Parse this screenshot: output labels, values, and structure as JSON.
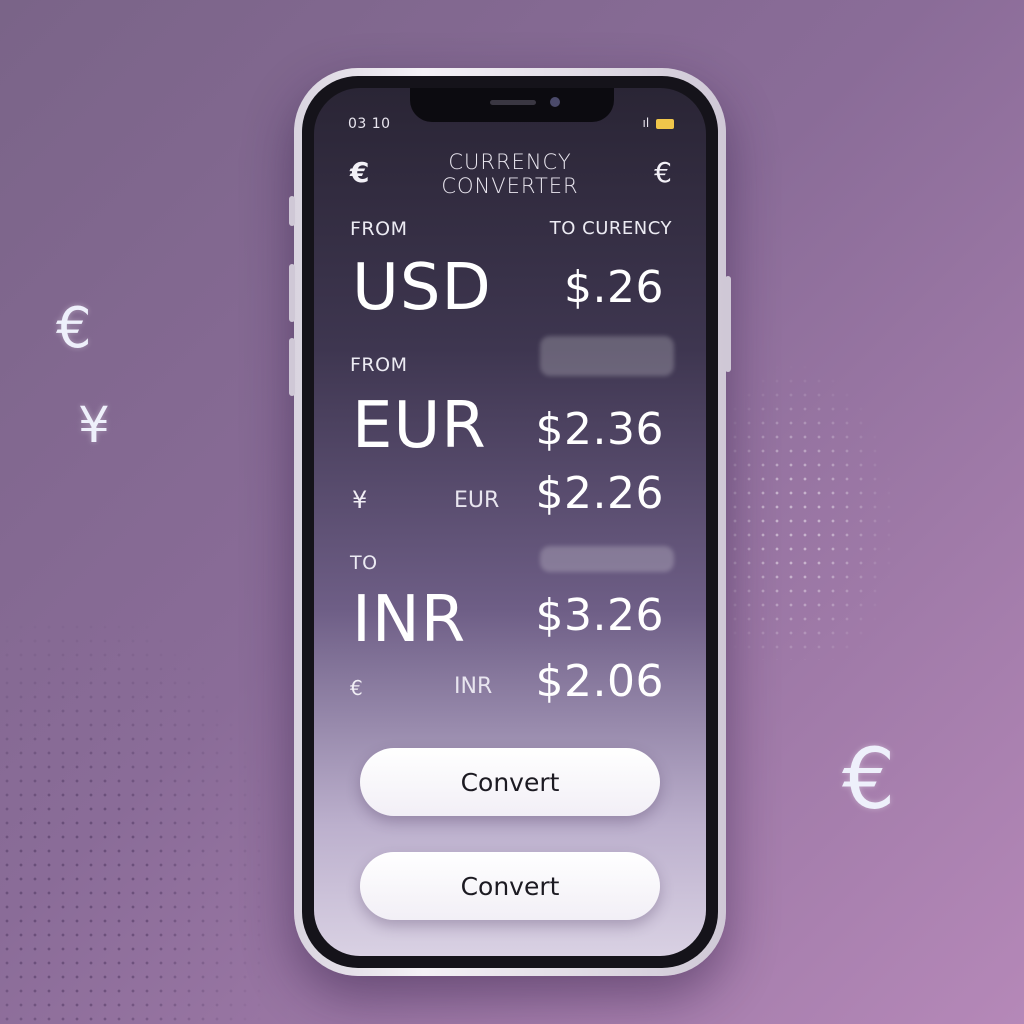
{
  "status_bar": {
    "time": "03 10",
    "signal": "ıl"
  },
  "header": {
    "title": "CURRENCY CONVERTER",
    "left_icon": "euro-icon",
    "right_icon": "euro-icon",
    "left_glyph": "€",
    "right_glyph": "€"
  },
  "section_1": {
    "from_label": "FROM",
    "to_label": "TO CURENCY",
    "code": "USD",
    "amount": "$.26"
  },
  "section_2": {
    "from_label": "FROM",
    "code": "EUR",
    "amount": "$2.36",
    "sub_icon": "¥",
    "sub_code": "EUR",
    "sub_amount": "$2.26"
  },
  "section_3": {
    "to_label": "TO",
    "code": "INR",
    "amount": "$3.26",
    "sub_icon": "€",
    "sub_code": "INR",
    "sub_amount": "$2.06"
  },
  "buttons": {
    "primary_label": "Convert",
    "secondary_label": "Convert"
  },
  "background_symbols": {
    "euro": "€",
    "yen": "¥"
  },
  "colors": {
    "background": "#8a6c98",
    "accent": "#b588b8",
    "screen_dark": "#2a2535",
    "button": "#ffffff"
  }
}
